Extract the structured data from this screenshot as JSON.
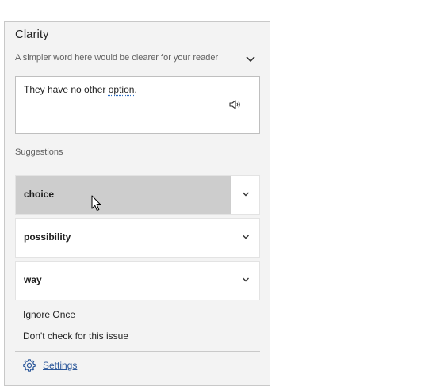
{
  "pane": {
    "title": "Clarity",
    "issue_description": "A simpler word here would be clearer for your reader",
    "context": {
      "before": "They have no other ",
      "flagged_word": "option",
      "after": "."
    },
    "suggestions_label": "Suggestions",
    "suggestions": [
      {
        "label": "choice"
      },
      {
        "label": "possibility"
      },
      {
        "label": "way"
      }
    ],
    "actions": {
      "ignore_once": "Ignore Once",
      "dont_check": "Don't check for this issue"
    },
    "settings_label": "Settings"
  },
  "icons": {
    "issue_expand": "chevron-down-icon",
    "read_aloud": "speaker-icon",
    "suggestion_expand": "chevron-down-icon",
    "settings": "gear-icon",
    "pointer": "mouse-cursor"
  },
  "colors": {
    "pane_background": "#f3f3f3",
    "hovered_suggestion": "#cdcdcd",
    "link": "#2b579a",
    "flag_underline": "#2b6bbf"
  }
}
